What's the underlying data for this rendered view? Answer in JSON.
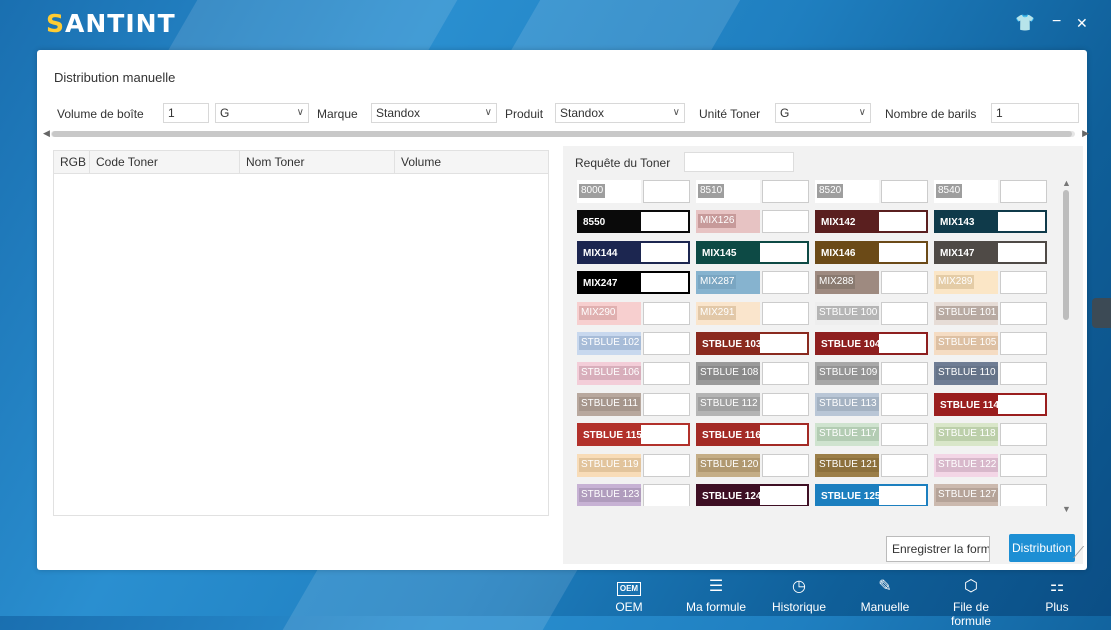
{
  "app": {
    "brand": "SANTINT"
  },
  "window": {
    "title": "Distribution manuelle"
  },
  "filters": {
    "volume_label": "Volume de boîte",
    "volume_value": "1",
    "unit_value": "G",
    "marque_label": "Marque",
    "marque_value": "Standox",
    "produit_label": "Produit",
    "produit_value": "Standox",
    "unite_toner_label": "Unité Toner",
    "unite_toner_value": "G",
    "barils_label": "Nombre de barils",
    "barils_value": "1"
  },
  "table": {
    "headers": [
      "RGB",
      "Code Toner",
      "Nom Toner",
      "Volume"
    ]
  },
  "toner": {
    "query_label": "Requête du Toner",
    "items": [
      {
        "name": "8000",
        "bg": "#ffffff",
        "tag_bg": "#9e9e9e",
        "fg": "#ffffff",
        "full": false
      },
      {
        "name": "8510",
        "bg": "#ffffff",
        "tag_bg": "#9e9e9e",
        "fg": "#ffffff",
        "full": false
      },
      {
        "name": "8520",
        "bg": "#ffffff",
        "tag_bg": "#9e9e9e",
        "fg": "#ffffff",
        "full": false
      },
      {
        "name": "8540",
        "bg": "#ffffff",
        "tag_bg": "#9e9e9e",
        "fg": "#ffffff",
        "full": false
      },
      {
        "name": "8550",
        "bg": "#0a0a0a",
        "tag_bg": "",
        "fg": "#ffffff",
        "full": true
      },
      {
        "name": "MIX126",
        "bg": "#e7c3c3",
        "tag_bg": "#c79a9a",
        "fg": "#ffffff",
        "full": false
      },
      {
        "name": "MIX142",
        "bg": "#5a1f1f",
        "tag_bg": "",
        "fg": "#ffffff",
        "full": true
      },
      {
        "name": "MIX143",
        "bg": "#0f3a4a",
        "tag_bg": "",
        "fg": "#ffffff",
        "full": true
      },
      {
        "name": "MIX144",
        "bg": "#1c2650",
        "tag_bg": "",
        "fg": "#ffffff",
        "full": true
      },
      {
        "name": "MIX145",
        "bg": "#0d4a45",
        "tag_bg": "",
        "fg": "#ffffff",
        "full": true
      },
      {
        "name": "MIX146",
        "bg": "#6b4a17",
        "tag_bg": "",
        "fg": "#ffffff",
        "full": true
      },
      {
        "name": "MIX147",
        "bg": "#4f4a46",
        "tag_bg": "",
        "fg": "#ffffff",
        "full": true
      },
      {
        "name": "MIX247",
        "bg": "#000000",
        "tag_bg": "",
        "fg": "#ffffff",
        "full": true
      },
      {
        "name": "MIX287",
        "bg": "#86b3cf",
        "tag_bg": "#7aa6c2",
        "fg": "#ffffff",
        "full": false
      },
      {
        "name": "MIX288",
        "bg": "#9e8a80",
        "tag_bg": "#8a7a70",
        "fg": "#ffffff",
        "full": false
      },
      {
        "name": "MIX289",
        "bg": "#fbe6c6",
        "tag_bg": "#e4cca6",
        "fg": "#ffffff",
        "full": false
      },
      {
        "name": "MIX290",
        "bg": "#f7cfcf",
        "tag_bg": "#e0b0b0",
        "fg": "#ffffff",
        "full": false
      },
      {
        "name": "MIX291",
        "bg": "#fae5cc",
        "tag_bg": "#e2c8a8",
        "fg": "#ffffff",
        "full": false
      },
      {
        "name": "STBLUE 100",
        "bg": "#eeeeee",
        "tag_bg": "#b5b5b5",
        "fg": "#ffffff",
        "full": false
      },
      {
        "name": "STBLUE 101",
        "bg": "#e6dcd6",
        "tag_bg": "#b8aaa2",
        "fg": "#ffffff",
        "full": false
      },
      {
        "name": "STBLUE 102",
        "bg": "#c8d8ee",
        "tag_bg": "#a7bcd8",
        "fg": "#ffffff",
        "full": false
      },
      {
        "name": "STBLUE 103",
        "bg": "#8a2a1f",
        "tag_bg": "",
        "fg": "#ffffff",
        "full": true
      },
      {
        "name": "STBLUE 104",
        "bg": "#8e1f1f",
        "tag_bg": "",
        "fg": "#ffffff",
        "full": true
      },
      {
        "name": "STBLUE 105",
        "bg": "#f5dcc3",
        "tag_bg": "#ddc0a3",
        "fg": "#ffffff",
        "full": false
      },
      {
        "name": "STBLUE 106",
        "bg": "#f3cdd8",
        "tag_bg": "#d8aebb",
        "fg": "#ffffff",
        "full": false
      },
      {
        "name": "STBLUE 108",
        "bg": "#9a9a9a",
        "tag_bg": "#8a8a8a",
        "fg": "#ffffff",
        "full": false
      },
      {
        "name": "STBLUE 109",
        "bg": "#a8a8a8",
        "tag_bg": "#959595",
        "fg": "#ffffff",
        "full": false
      },
      {
        "name": "STBLUE 110",
        "bg": "#6f7d94",
        "tag_bg": "#667489",
        "fg": "#ffffff",
        "full": false
      },
      {
        "name": "STBLUE 111",
        "bg": "#b8a89e",
        "tag_bg": "#a6968c",
        "fg": "#ffffff",
        "full": false
      },
      {
        "name": "STBLUE 112",
        "bg": "#b4b4b4",
        "tag_bg": "#a0a0a0",
        "fg": "#ffffff",
        "full": false
      },
      {
        "name": "STBLUE 113",
        "bg": "#b9c6d6",
        "tag_bg": "#a4b2c2",
        "fg": "#ffffff",
        "full": false
      },
      {
        "name": "STBLUE 114",
        "bg": "#9a1e1e",
        "tag_bg": "",
        "fg": "#ffffff",
        "full": true
      },
      {
        "name": "STBLUE 115",
        "bg": "#b2312b",
        "tag_bg": "",
        "fg": "#ffffff",
        "full": true
      },
      {
        "name": "STBLUE 116",
        "bg": "#a32a25",
        "tag_bg": "",
        "fg": "#ffffff",
        "full": true
      },
      {
        "name": "STBLUE 117",
        "bg": "#cfe3cf",
        "tag_bg": "#b3ccb3",
        "fg": "#ffffff",
        "full": false
      },
      {
        "name": "STBLUE 118",
        "bg": "#d9e6c9",
        "tag_bg": "#bccfaa",
        "fg": "#ffffff",
        "full": false
      },
      {
        "name": "STBLUE 119",
        "bg": "#f8dcb8",
        "tag_bg": "#e2c49c",
        "fg": "#ffffff",
        "full": false
      },
      {
        "name": "STBLUE 120",
        "bg": "#c4ad86",
        "tag_bg": "#b09870",
        "fg": "#ffffff",
        "full": false
      },
      {
        "name": "STBLUE 121",
        "bg": "#9b7e48",
        "tag_bg": "#8c703c",
        "fg": "#ffffff",
        "full": false
      },
      {
        "name": "STBLUE 122",
        "bg": "#f3d6e6",
        "tag_bg": "#d8b8cb",
        "fg": "#ffffff",
        "full": false
      },
      {
        "name": "STBLUE 123",
        "bg": "#c7b2d4",
        "tag_bg": "#b09cbd",
        "fg": "#ffffff",
        "full": false
      },
      {
        "name": "STBLUE 124",
        "bg": "#3e0f24",
        "tag_bg": "",
        "fg": "#ffffff",
        "full": true
      },
      {
        "name": "STBLUE 125",
        "bg": "#1c7fbf",
        "tag_bg": "",
        "fg": "#ffffff",
        "full": true
      },
      {
        "name": "STBLUE 127",
        "bg": "#cbb9ae",
        "tag_bg": "#b5a398",
        "fg": "#ffffff",
        "full": false
      }
    ]
  },
  "actions": {
    "save_label": "Enregistrer la formule",
    "distribute_label": "Distribution"
  },
  "nav": [
    {
      "id": "oem",
      "label": "OEM",
      "icon": "oem-icon"
    },
    {
      "id": "ma-formule",
      "label": "Ma formule",
      "icon": "list-icon"
    },
    {
      "id": "historique",
      "label": "Historique",
      "icon": "history-icon"
    },
    {
      "id": "manuelle",
      "label": "Manuelle",
      "icon": "pen-icon"
    },
    {
      "id": "file-formule",
      "label": "File de formule",
      "icon": "cube-icon"
    },
    {
      "id": "plus",
      "label": "Plus",
      "icon": "grid-icon"
    }
  ],
  "nav_glyphs": {
    "oem": "OEM",
    "ma-formule": "☰",
    "historique": "◷",
    "manuelle": "✎",
    "file-formule": "⬡",
    "plus": "⚏"
  }
}
